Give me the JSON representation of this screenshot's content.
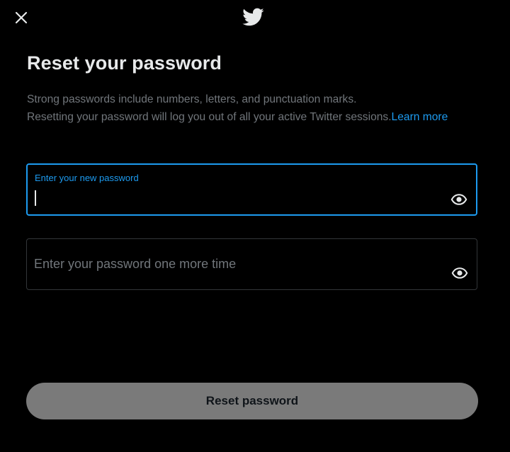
{
  "header": {
    "close_icon": "close-icon",
    "logo_icon": "twitter-bird-icon"
  },
  "main": {
    "title": "Reset your password",
    "description_line1": "Strong passwords include numbers, letters, and punctuation marks.",
    "description_line2": "Resetting your password will log you out of all your active Twitter sessions.",
    "learn_more": "Learn more"
  },
  "fields": {
    "new_password": {
      "label": "Enter your new password",
      "value": "",
      "state": "focused",
      "toggle_icon": "eye-icon"
    },
    "confirm_password": {
      "placeholder": "Enter your password one more time",
      "value": "",
      "toggle_icon": "eye-icon"
    }
  },
  "actions": {
    "reset_label": "Reset password",
    "reset_state": "disabled"
  },
  "colors": {
    "background": "#000000",
    "accent": "#1d9bf0",
    "text_primary": "#e7e9ea",
    "text_secondary": "#71767b",
    "border": "#333639",
    "button_disabled": "#7a7a7a"
  }
}
